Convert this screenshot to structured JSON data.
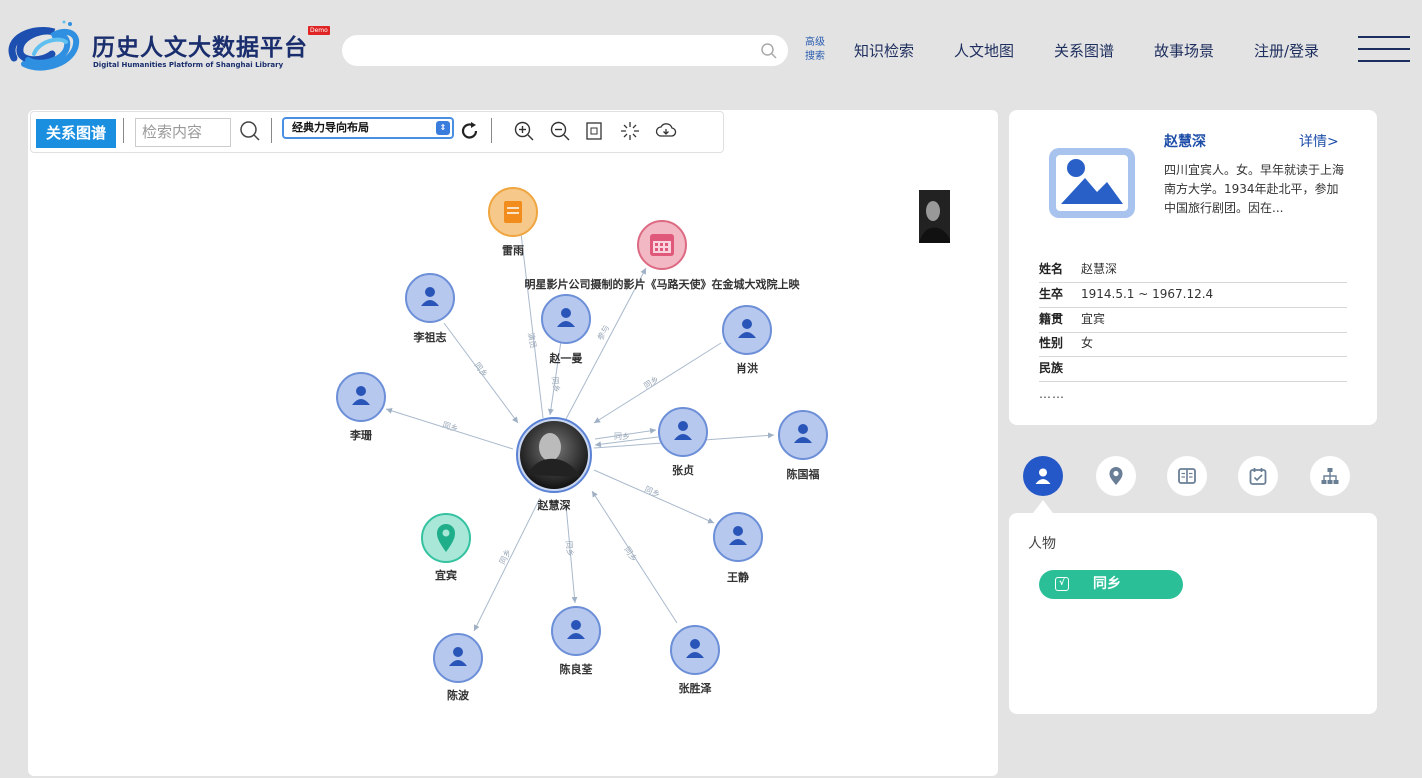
{
  "header": {
    "title": "历史人文大数据平台",
    "demo_badge": "Demo",
    "subtitle": "Digital Humanities Platform of Shanghai Library",
    "search_placeholder": "",
    "advanced_search": "高级搜索",
    "nav": [
      "知识检索",
      "人文地图",
      "关系图谱",
      "故事场景",
      "注册/登录"
    ]
  },
  "toolbar": {
    "title": "关系图谱",
    "search_placeholder": "检索内容",
    "layout_select": "经典力导向布局",
    "icons": [
      "search-icon",
      "refresh-icon",
      "zoom-in-icon",
      "zoom-out-icon",
      "fit-screen-icon",
      "center-icon",
      "download-icon"
    ]
  },
  "graph": {
    "center": "赵慧深",
    "nodes": [
      "雷雨",
      "明星影片公司摄制的影片《马路天使》在金城大戏院上映",
      "李祖志",
      "赵一曼",
      "肖洪",
      "李珊",
      "张贞",
      "陈国福",
      "王静",
      "宜宾",
      "陈良荃",
      "陈波",
      "张胜泽"
    ],
    "edge_labels": [
      "演员",
      "参与",
      "同乡",
      "同乡",
      "同乡",
      "同乡",
      "同乡",
      "同乡",
      "同乡",
      "同乡",
      "同乡",
      "同乡",
      "同乡"
    ]
  },
  "profile": {
    "name": "赵慧深",
    "detail_link": "详情>",
    "description": "四川宜宾人。女。早年就读于上海南方大学。1934年赴北平，参加中国旅行剧团。因在...",
    "fields": [
      {
        "label": "姓名",
        "value": "赵慧深"
      },
      {
        "label": "生卒",
        "value": "1914.5.1 ~ 1967.12.4"
      },
      {
        "label": "籍贯",
        "value": "宜宾"
      },
      {
        "label": "性别",
        "value": "女"
      },
      {
        "label": "民族",
        "value": ""
      }
    ],
    "more": "……"
  },
  "categories": [
    "person-icon",
    "location-icon",
    "book-icon",
    "calendar-icon",
    "org-chart-icon"
  ],
  "relations": {
    "title": "人物",
    "chip": "同乡"
  },
  "colors": {
    "accent": "#2458c8",
    "toolbar_title": "#1a8fe0",
    "person_node": "#b7c8ee",
    "chip": "#2bbf98"
  }
}
